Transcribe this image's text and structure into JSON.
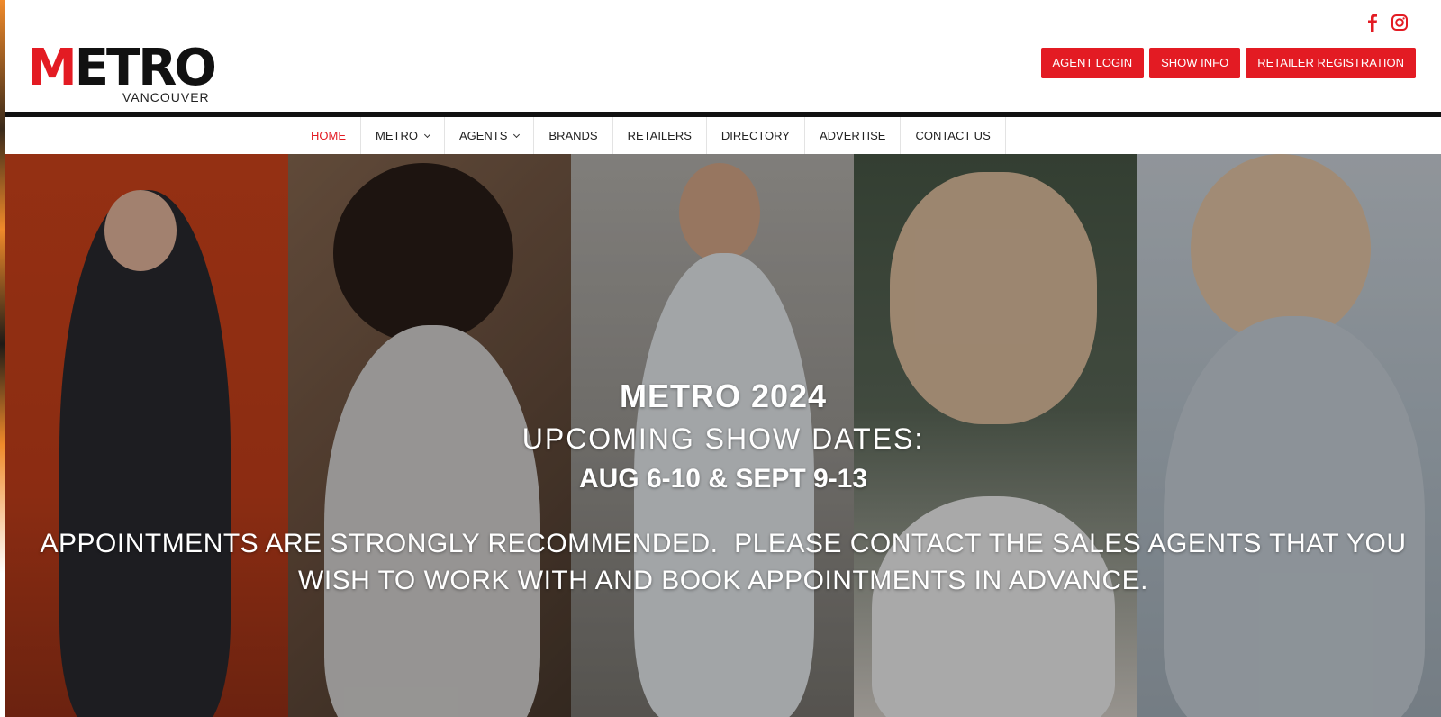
{
  "brand": {
    "logo_main": "METRO",
    "logo_first_letter": "M",
    "logo_rest": "ETRO",
    "logo_sub": "VANCOUVER",
    "accent": "#e31b23"
  },
  "social": [
    {
      "icon": "facebook-icon"
    },
    {
      "icon": "instagram-icon"
    }
  ],
  "top_buttons": {
    "agent_login": "AGENT LOGIN",
    "show_info": "SHOW INFO",
    "retailer_registration": "RETAILER REGISTRATION"
  },
  "nav": {
    "items": [
      {
        "label": "HOME",
        "active": true
      },
      {
        "label": "METRO",
        "dropdown": true
      },
      {
        "label": "AGENTS",
        "dropdown": true
      },
      {
        "label": "BRANDS"
      },
      {
        "label": "RETAILERS"
      },
      {
        "label": "DIRECTORY"
      },
      {
        "label": "ADVERTISE"
      },
      {
        "label": "CONTACT US"
      }
    ]
  },
  "hero": {
    "title": "METRO 2024",
    "subtitle": "UPCOMING SHOW DATES:",
    "dates": "AUG 6-10 & SEPT 9-13",
    "notice_line1": "APPOINTMENTS ARE STRONGLY RECOMMENDED.  PLEASE CONTACT THE SALES AGENTS THAT YOU",
    "notice_line2": "WISH TO WORK WITH AND BOOK APPOINTMENTS IN ADVANCE."
  }
}
